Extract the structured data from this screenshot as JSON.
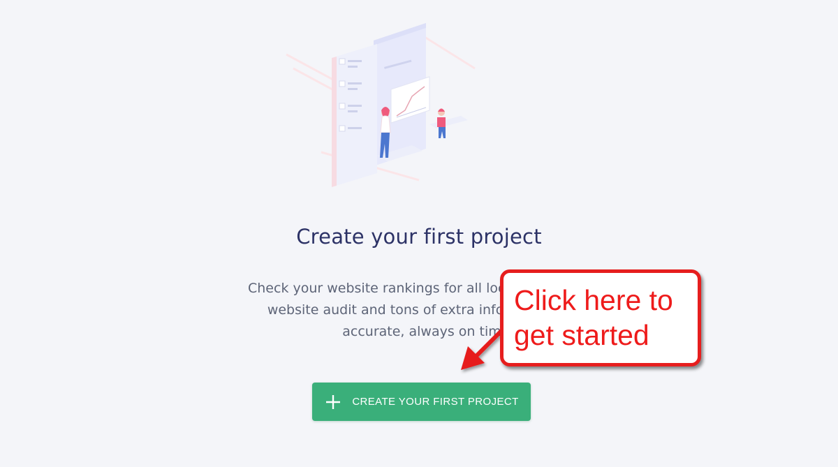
{
  "empty_state": {
    "title": "Create your first project",
    "description_lines": [
      "Check your website rankings for all locations and de",
      "website audit and tons of extra information pe",
      "accurate, always on tim"
    ],
    "cta_label": "CREATE YOUR FIRST PROJECT",
    "cta_icon": "plus-icon",
    "cta_color": "#3aaf7a"
  },
  "annotation": {
    "callout_lines": [
      "Click here to",
      "get started"
    ],
    "color": "#e61e1e",
    "arrow_icon": "arrow-icon"
  },
  "illustration": {
    "icon": "project-illustration"
  }
}
